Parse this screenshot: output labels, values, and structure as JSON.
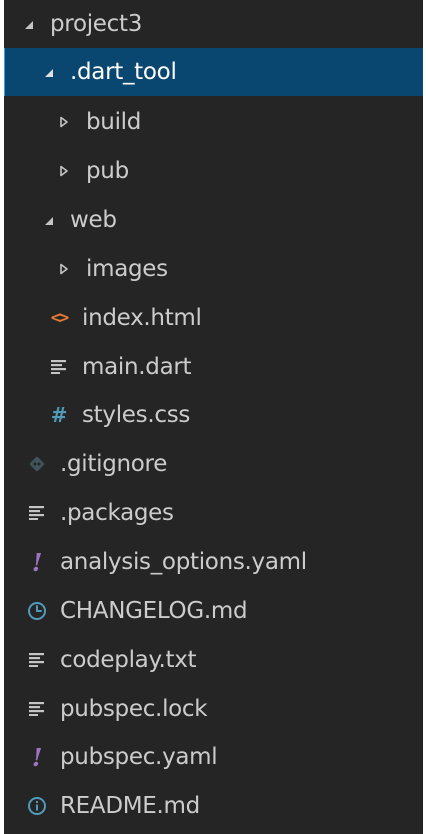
{
  "explorer": {
    "root": {
      "label": "project3",
      "icon": "chevron-down-icon"
    },
    "dart_tool": {
      "label": ".dart_tool",
      "icon": "chevron-down-icon",
      "selected": true
    },
    "build": {
      "label": "build",
      "icon": "chevron-right-icon"
    },
    "pub": {
      "label": "pub",
      "icon": "chevron-right-icon"
    },
    "web": {
      "label": "web",
      "icon": "chevron-down-icon"
    },
    "images": {
      "label": "images",
      "icon": "chevron-right-icon"
    },
    "index_html": {
      "label": "index.html",
      "icon": "html-file-icon",
      "glyph": "<>"
    },
    "main_dart": {
      "label": "main.dart",
      "icon": "text-file-icon"
    },
    "styles_css": {
      "label": "styles.css",
      "icon": "css-file-icon",
      "glyph": "#"
    },
    "gitignore": {
      "label": ".gitignore",
      "icon": "git-file-icon"
    },
    "packages": {
      "label": ".packages",
      "icon": "text-file-icon"
    },
    "analysis_options": {
      "label": "analysis_options.yaml",
      "icon": "yaml-file-icon",
      "glyph": "!"
    },
    "changelog": {
      "label": "CHANGELOG.md",
      "icon": "clock-icon"
    },
    "codeplay": {
      "label": "codeplay.txt",
      "icon": "text-file-icon"
    },
    "pubspec_lock": {
      "label": "pubspec.lock",
      "icon": "text-file-icon"
    },
    "pubspec_yaml": {
      "label": "pubspec.yaml",
      "icon": "yaml-file-icon",
      "glyph": "!"
    },
    "readme": {
      "label": "README.md",
      "icon": "info-icon"
    }
  },
  "colors": {
    "background": "#252526",
    "selection": "#094771",
    "text": "#cccccc",
    "css_icon": "#519aba",
    "html_icon": "#e37933",
    "yaml_icon": "#a074c4",
    "info_icon": "#519aba"
  }
}
